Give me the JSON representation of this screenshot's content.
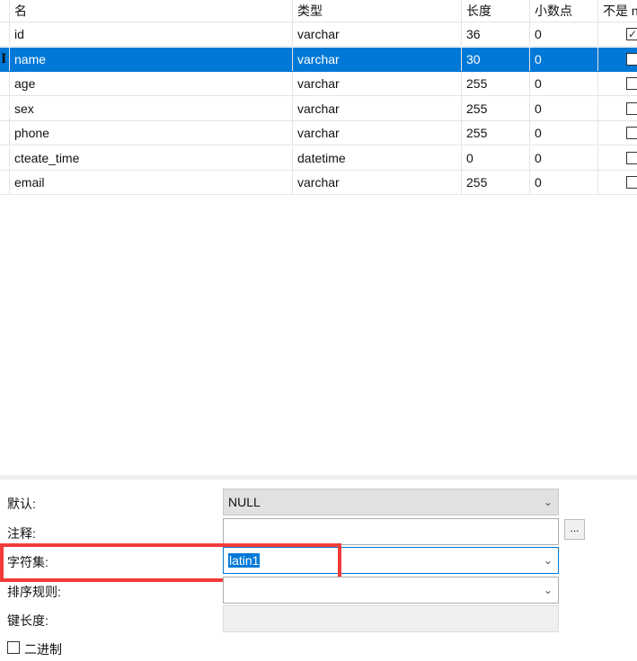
{
  "table": {
    "headers": [
      "名",
      "类型",
      "长度",
      "小数点",
      "不是 null"
    ],
    "rows": [
      {
        "name": "id",
        "type": "varchar",
        "length": "36",
        "decimal": "0",
        "not_null": true
      },
      {
        "name": "name",
        "type": "varchar",
        "length": "30",
        "decimal": "0",
        "not_null": false
      },
      {
        "name": "age",
        "type": "varchar",
        "length": "255",
        "decimal": "0",
        "not_null": false
      },
      {
        "name": "sex",
        "type": "varchar",
        "length": "255",
        "decimal": "0",
        "not_null": false
      },
      {
        "name": "phone",
        "type": "varchar",
        "length": "255",
        "decimal": "0",
        "not_null": false
      },
      {
        "name": "cteate_time",
        "type": "datetime",
        "length": "0",
        "decimal": "0",
        "not_null": false
      },
      {
        "name": "email",
        "type": "varchar",
        "length": "255",
        "decimal": "0",
        "not_null": false
      }
    ],
    "selected_index": 1
  },
  "props": {
    "default_label": "默认:",
    "default_value": "NULL",
    "comment_label": "注释:",
    "comment_value": "",
    "comment_button": "...",
    "charset_label": "字符集:",
    "charset_value": "latin1",
    "collation_label": "排序规则:",
    "collation_value": "",
    "keylen_label": "键长度:",
    "keylen_value": "",
    "binary_label": "二进制",
    "binary_checked": false
  }
}
